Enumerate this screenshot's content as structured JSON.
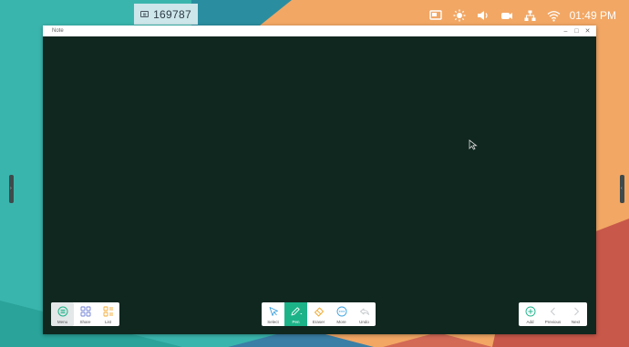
{
  "taskbar": {
    "code": "169787",
    "clock": "01:49 PM",
    "icons": [
      "screen-share-icon",
      "brightness-icon",
      "volume-icon",
      "camera-icon",
      "network-icon",
      "wifi-icon"
    ]
  },
  "window": {
    "title": "Note",
    "controls": [
      "minimize-icon",
      "maximize-icon",
      "close-icon"
    ]
  },
  "left_toolbar": {
    "items": [
      {
        "label": "Menu",
        "icon": "menu-icon"
      },
      {
        "label": "Share",
        "icon": "share-icon"
      },
      {
        "label": "List",
        "icon": "list-icon"
      }
    ]
  },
  "center_toolbar": {
    "items": [
      {
        "label": "Select",
        "icon": "select-icon"
      },
      {
        "label": "Pen",
        "icon": "pen-icon"
      },
      {
        "label": "Eraser",
        "icon": "eraser-icon"
      },
      {
        "label": "More",
        "icon": "more-icon"
      },
      {
        "label": "Undo",
        "icon": "undo-icon"
      }
    ],
    "selected": "Pen"
  },
  "right_toolbar": {
    "items": [
      {
        "label": "Add",
        "icon": "add-icon"
      },
      {
        "label": "Previous",
        "icon": "previous-icon"
      },
      {
        "label": "Next",
        "icon": "next-icon"
      }
    ]
  },
  "colors": {
    "canvas": "#10271f",
    "accent": "#1db389",
    "wallpaper_teal": "#3ab5ad",
    "wallpaper_orange": "#f2a764",
    "wallpaper_red": "#c8584a"
  }
}
